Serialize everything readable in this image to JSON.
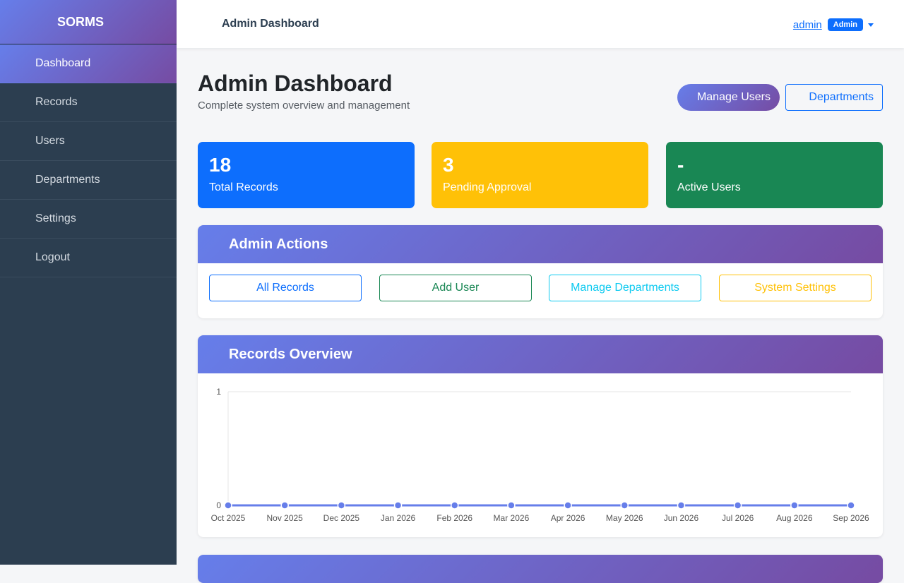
{
  "sidebar": {
    "brand": "SORMS",
    "items": [
      {
        "label": "Dashboard"
      },
      {
        "label": "Records"
      },
      {
        "label": "Users"
      },
      {
        "label": "Departments"
      },
      {
        "label": "Settings"
      },
      {
        "label": "Logout"
      }
    ]
  },
  "topbar": {
    "title": "Admin Dashboard",
    "user": "admin",
    "role_badge": "Admin"
  },
  "header": {
    "title": "Admin Dashboard",
    "subtitle": "Complete system overview and management",
    "manage_users_label": "Manage Users",
    "departments_label": "Departments"
  },
  "stats": [
    {
      "value": "18",
      "label": "Total Records",
      "color": "#0d6efd"
    },
    {
      "value": "3",
      "label": "Pending Approval",
      "color": "#ffc107"
    },
    {
      "value": "-",
      "label": "Active Users",
      "color": "#198754"
    }
  ],
  "admin_actions": {
    "title": "Admin Actions",
    "buttons": [
      {
        "label": "All Records",
        "color": "#0d6efd"
      },
      {
        "label": "Add User",
        "color": "#198754"
      },
      {
        "label": "Manage Departments",
        "color": "#0dcaf0"
      },
      {
        "label": "System Settings",
        "color": "#ffc107"
      }
    ]
  },
  "records_overview": {
    "title": "Records Overview"
  },
  "chart_data": {
    "type": "line",
    "categories": [
      "Oct 2025",
      "Nov 2025",
      "Dec 2025",
      "Jan 2026",
      "Feb 2026",
      "Mar 2026",
      "Apr 2026",
      "May 2026",
      "Jun 2026",
      "Jul 2026",
      "Aug 2026",
      "Sep 2026"
    ],
    "series": [
      {
        "values": [
          0,
          0,
          0,
          0,
          0,
          0,
          0,
          0,
          0,
          0,
          0,
          0
        ],
        "color": "#667eea"
      }
    ],
    "yticks": [
      "0",
      "1"
    ],
    "ylim": [
      0,
      1
    ],
    "grid": true
  },
  "colors": {
    "sidebar_bg": "#2c3e50",
    "gradient_start": "#667eea",
    "gradient_end": "#764ba2"
  }
}
